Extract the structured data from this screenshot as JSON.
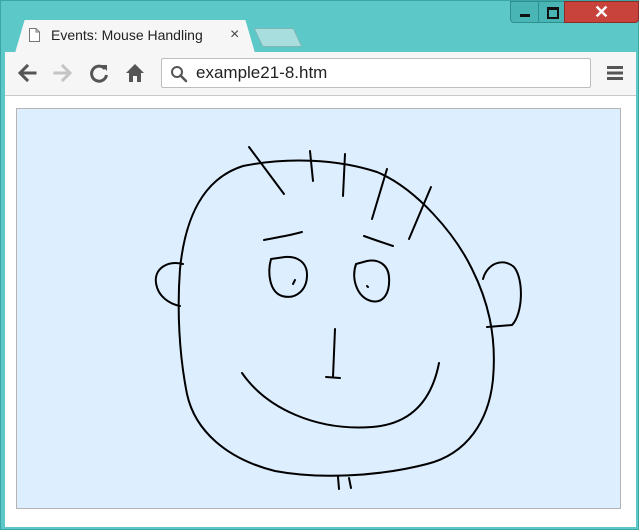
{
  "browser": {
    "tab": {
      "title": "Events: Mouse Handling",
      "close_glyph": "×",
      "page_icon": "page-icon"
    },
    "window_controls": {
      "minimize_icon": "minimize-icon",
      "maximize_icon": "maximize-icon",
      "close_glyph": "✕"
    },
    "toolbar": {
      "back_icon": "arrow-left-icon",
      "forward_icon": "arrow-right-icon",
      "reload_icon": "reload-icon",
      "home_icon": "home-icon",
      "menu_icon": "hamburger-menu-icon"
    },
    "address_bar": {
      "search_icon": "search-icon",
      "value": "example21-8.htm"
    }
  },
  "page": {
    "canvas": {
      "background": "#ddeeff",
      "stroke": "#000000",
      "content": "freehand mouse drawing of a smiling face"
    }
  },
  "colors": {
    "frame": "#5cc8c8",
    "close_button": "#c7433c",
    "toolbar": "#f6f6f6"
  }
}
